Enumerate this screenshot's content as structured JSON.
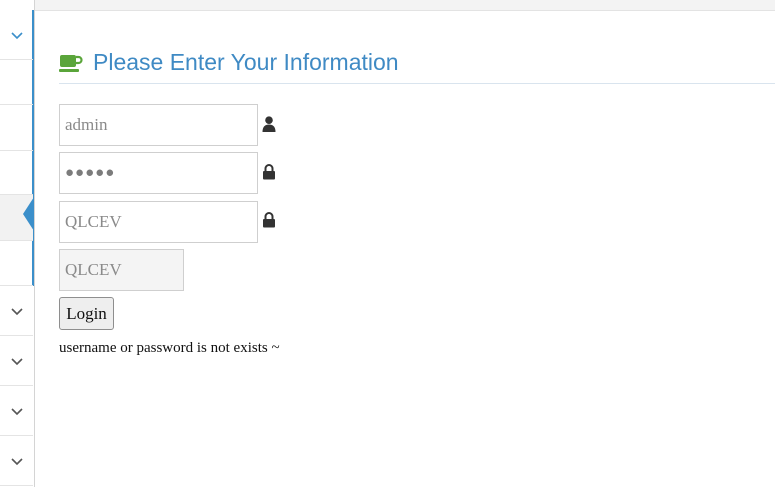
{
  "header": {
    "title": "Please Enter Your Information",
    "icon": "coffee-cup-icon",
    "icon_color": "#5aa53a",
    "title_color": "#3f8ac4"
  },
  "form": {
    "username": {
      "value": "admin",
      "icon": "user-icon"
    },
    "password": {
      "value": "●●●●●",
      "icon": "lock-icon"
    },
    "captcha_input": {
      "value": "QLCEV",
      "icon": "lock-icon"
    },
    "captcha_display": {
      "value": "QLCEV"
    },
    "login_label": "Login",
    "error_message": "username or password is not exists ~"
  },
  "sidebar": {
    "accent_color": "#3b8fca",
    "icons": [
      "chevron-down-icon",
      "chevron-down-icon",
      "chevron-down-icon",
      "chevron-down-icon",
      "chevron-down-icon"
    ]
  }
}
